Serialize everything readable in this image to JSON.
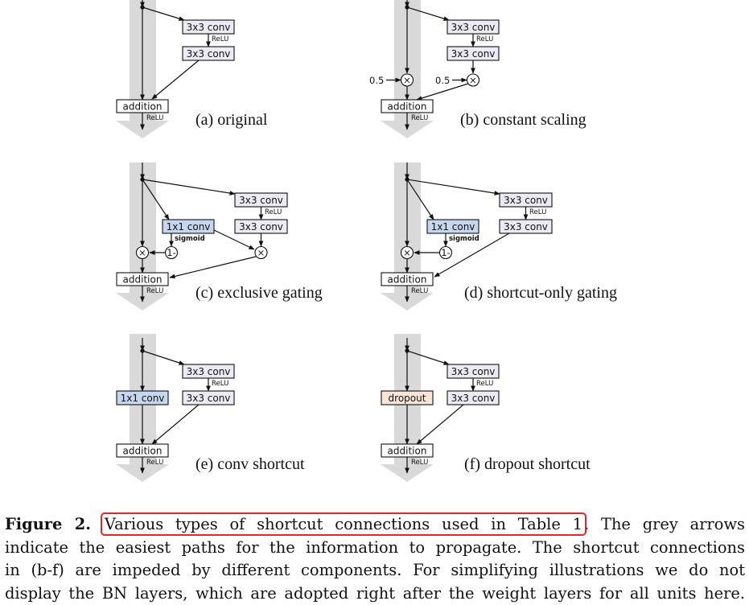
{
  "figure": {
    "panels": [
      {
        "id": "a",
        "label": "(a) original",
        "conv1": "3x3 conv",
        "conv2": "3x3 conv",
        "relu_mid": "ReLU",
        "addition": "addition",
        "relu_out": "ReLU"
      },
      {
        "id": "b",
        "label": "(b) constant scaling",
        "conv1": "3x3 conv",
        "conv2": "3x3 conv",
        "relu_mid": "ReLU",
        "addition": "addition",
        "relu_out": "ReLU",
        "scale_left": "0.5",
        "scale_right": "0.5",
        "multiply": "×"
      },
      {
        "id": "c",
        "label": "(c) exclusive gating",
        "conv1": "3x3 conv",
        "conv2": "3x3 conv",
        "relu_mid": "ReLU",
        "gate": "1x1 conv",
        "gate_act": "sigmoid",
        "one_minus": "1-",
        "multiply": "×",
        "addition": "addition",
        "relu_out": "ReLU"
      },
      {
        "id": "d",
        "label": "(d) shortcut-only gating",
        "conv1": "3x3 conv",
        "conv2": "3x3 conv",
        "relu_mid": "ReLU",
        "gate": "1x1 conv",
        "gate_act": "sigmoid",
        "one_minus": "1-",
        "multiply": "×",
        "addition": "addition",
        "relu_out": "ReLU"
      },
      {
        "id": "e",
        "label": "(e) conv shortcut",
        "conv1": "3x3 conv",
        "conv2": "3x3 conv",
        "relu_mid": "ReLU",
        "shortcut_op": "1x1 conv",
        "addition": "addition",
        "relu_out": "ReLU"
      },
      {
        "id": "f",
        "label": "(f) dropout shortcut",
        "conv1": "3x3 conv",
        "conv2": "3x3 conv",
        "relu_mid": "ReLU",
        "shortcut_op": "dropout",
        "addition": "addition",
        "relu_out": "ReLU"
      }
    ],
    "colors": {
      "grey_arrow": "#d9d9d9",
      "conv_box_fill": "#ecebf3",
      "gate_box_fill": "#c6d6ee",
      "dropout_box_fill": "#fbe5d6",
      "addition_box_fill": "#ffffff",
      "highlight_outline": "#e8242a"
    }
  },
  "caption": {
    "label": "Figure 2.",
    "highlighted": "Various types of shortcut connections used in Table 1",
    "line1_rest": ". The grey arrows",
    "line2": "indicate the easiest paths for the information to propagate. The shortcut connections",
    "line3": "in (b-f) are impeded by different components. For simplifying illustrations we do not",
    "line4": "display the BN layers, which are adopted right after the weight layers for all units here."
  }
}
